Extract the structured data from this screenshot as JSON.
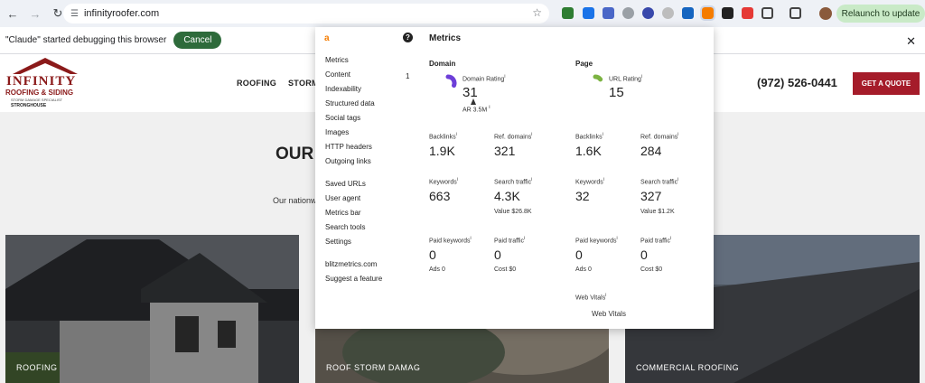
{
  "browser": {
    "url": "infinityroofer.com",
    "relaunch_label": "Relaunch to update",
    "nav_icons": [
      "back-icon",
      "forward-icon",
      "reload-icon",
      "site-info-icon",
      "bookmark-star-icon"
    ]
  },
  "debug_bar": {
    "message": "\"Claude\" started debugging this browser",
    "cancel_label": "Cancel"
  },
  "site": {
    "logo": {
      "line1": "INFINITY",
      "line2": "ROOFING & SIDING",
      "line3": "STORM DAMAGE SPECIALIST",
      "line4": "STRONGHOUSE",
      "colors": {
        "brand": "#8b1a1a"
      }
    },
    "nav": [
      "ROOFING",
      "STORM"
    ],
    "phone": "(972) 526-0441",
    "cta_label": "GET A QUOTE",
    "cta_color": "#a51c2a",
    "heading": "OUR",
    "subtext": "Our nationw",
    "cards": [
      {
        "label": "ROOFING"
      },
      {
        "label": "ROOF STORM DAMAG"
      },
      {
        "label": "COMMERCIAL ROOFING"
      }
    ]
  },
  "ahrefs": {
    "logo": "a",
    "help": "?",
    "menu_group1": [
      "Metrics",
      "Content",
      "Indexability",
      "Structured data",
      "Social tags",
      "Images",
      "HTTP headers",
      "Outgoing links"
    ],
    "content_count": "1",
    "menu_group2": [
      "Saved URLs",
      "User agent",
      "Metrics bar",
      "Search tools",
      "Settings"
    ],
    "menu_group3": [
      "blitzmetrics.com",
      "Suggest a feature"
    ],
    "title": "Metrics",
    "domain": {
      "title": "Domain",
      "rating_label": "Domain Rating",
      "rating_value": "31",
      "rating_fraction": 0.31,
      "ar_label": "AR 3.5M",
      "backlinks_label": "Backlinks",
      "backlinks": "1.9K",
      "ref_domains_label": "Ref. domains",
      "ref_domains": "321",
      "keywords_label": "Keywords",
      "keywords": "663",
      "search_traffic_label": "Search traffic",
      "search_traffic": "4.3K",
      "traffic_value": "Value $26.8K",
      "paid_keywords_label": "Paid keywords",
      "paid_keywords": "0",
      "ads": "Ads 0",
      "paid_traffic_label": "Paid traffic",
      "paid_traffic": "0",
      "cost": "Cost $0",
      "gauge_color": "#6d3fd8"
    },
    "page": {
      "title": "Page",
      "rating_label": "URL Rating",
      "rating_value": "15",
      "rating_fraction": 0.15,
      "backlinks_label": "Backlinks",
      "backlinks": "1.6K",
      "ref_domains_label": "Ref. domains",
      "ref_domains": "284",
      "keywords_label": "Keywords",
      "keywords": "32",
      "search_traffic_label": "Search traffic",
      "search_traffic": "327",
      "traffic_value": "Value $1.2K",
      "paid_keywords_label": "Paid keywords",
      "paid_keywords": "0",
      "ads": "Ads 0",
      "paid_traffic_label": "Paid traffic",
      "paid_traffic": "0",
      "cost": "Cost $0",
      "web_vitals_label": "Web Vitals",
      "web_vitals_link": "Web Vitals",
      "gauge_color": "#7cb342"
    },
    "info_mark": "i"
  }
}
